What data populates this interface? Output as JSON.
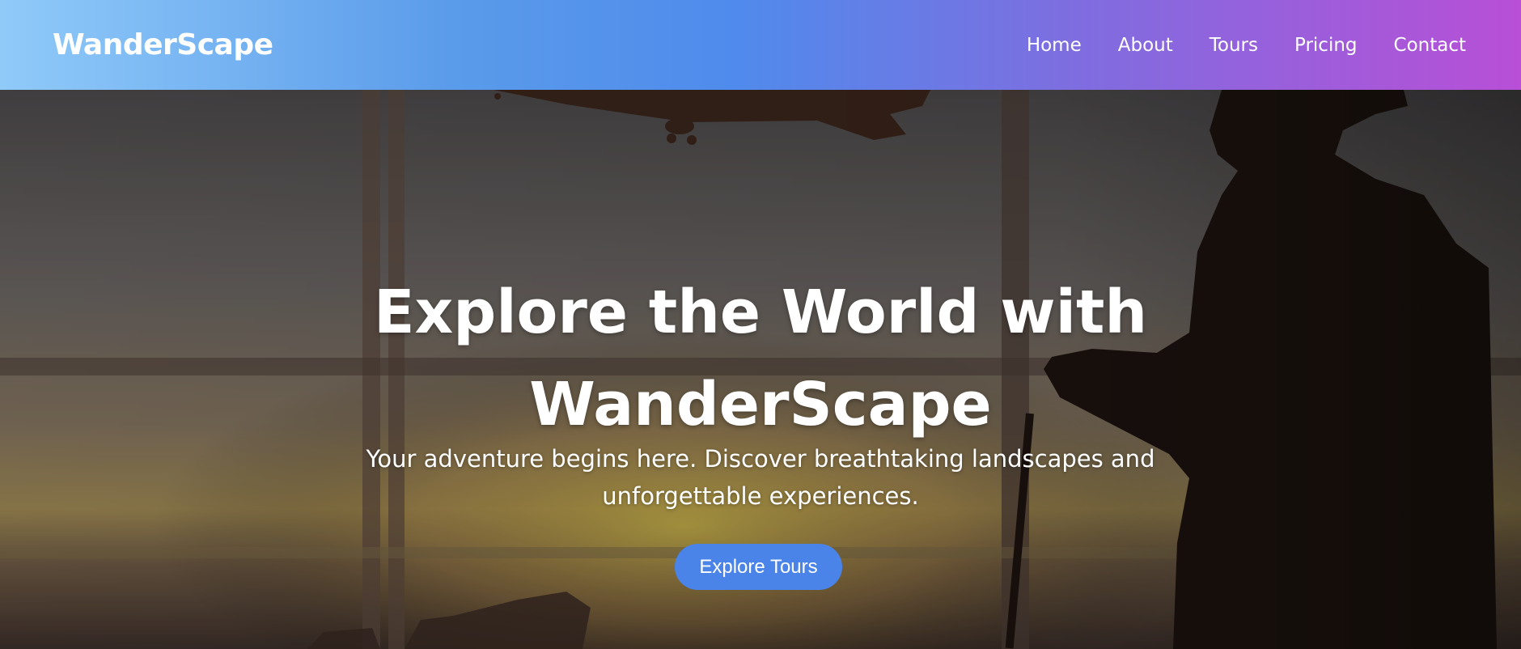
{
  "brand": {
    "name": "WanderScape"
  },
  "nav": {
    "links": [
      "Home",
      "About",
      "Tours",
      "Pricing",
      "Contact"
    ]
  },
  "hero": {
    "title_line1": "Explore the World with",
    "title_line2": "WanderScape",
    "subtitle_line1": "Your adventure begins here. Discover breathtaking landscapes and",
    "subtitle_line2": "unforgettable experiences.",
    "cta_label": "Explore Tours",
    "background_description_icons": [
      "airplane-silhouette",
      "traveler-silhouette"
    ]
  },
  "colors": {
    "nav_gradient_start": "#90caf9",
    "nav_gradient_mid": "#4f8bec",
    "nav_gradient_end": "#b84fd6",
    "cta_background": "#4a84e8",
    "text": "#ffffff"
  }
}
